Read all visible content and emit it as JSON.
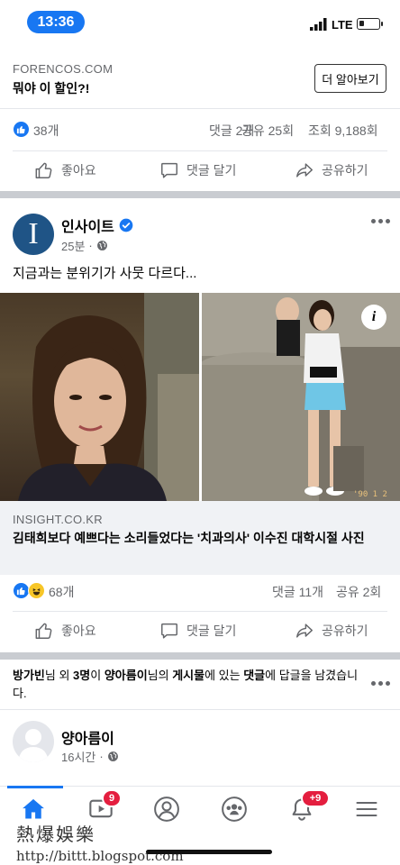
{
  "status_bar": {
    "time": "13:36",
    "network": "LTE"
  },
  "ad": {
    "domain": "FORENCOS.COM",
    "headline": "뭐야 이 할인?!",
    "cta": "더 알아보기",
    "reaction_count": "38개",
    "comments": "댓글 2개",
    "shares": "공유 25회",
    "views": "조회 9,188회"
  },
  "actions": {
    "like": "좋아요",
    "comment": "댓글 달기",
    "share": "공유하기"
  },
  "post": {
    "page_name": "인사이트",
    "time": "25분",
    "text": "지금과는 분위기가 사뭇 다르다...",
    "link_domain": "INSIGHT.CO.KR",
    "link_title": "김태희보다 예쁘다는 소리들었다는 '치과의사' 이수진 대학시절 사진",
    "reaction_count": "68개",
    "comments": "댓글 11개",
    "shares": "공유 2회",
    "photo_date_stamp": "'90 1 2",
    "info_badge": "i"
  },
  "notification": {
    "name_a": "방가빈",
    "mid_a": "님 외 ",
    "count": "3명",
    "mid_b": "이 ",
    "name_b": "양아름이",
    "mid_c": "님의 ",
    "post_word": "게시물",
    "mid_d": "에 있는 ",
    "comment_word": "댓글",
    "tail": "에 답글을 남겼습니다."
  },
  "next_post": {
    "author": "양아름이",
    "time": "16시간"
  },
  "tabbar": {
    "video_badge": "9",
    "notifications_badge": "+9"
  },
  "watermark": {
    "line1": "熱爆娛樂",
    "line2": "http://bittt.blogspot.com"
  },
  "icons": [
    "signal-icon",
    "battery-icon",
    "like-icon",
    "comment-icon",
    "share-icon",
    "verified-icon",
    "globe-icon",
    "more-icon",
    "home-icon",
    "video-icon",
    "profile-icon",
    "groups-icon",
    "bell-icon",
    "menu-icon"
  ],
  "colors": {
    "facebook_blue": "#1877f2",
    "badge_red": "#e41e3f",
    "text_gray": "#65676b",
    "haha_yellow": "#f7c628"
  }
}
